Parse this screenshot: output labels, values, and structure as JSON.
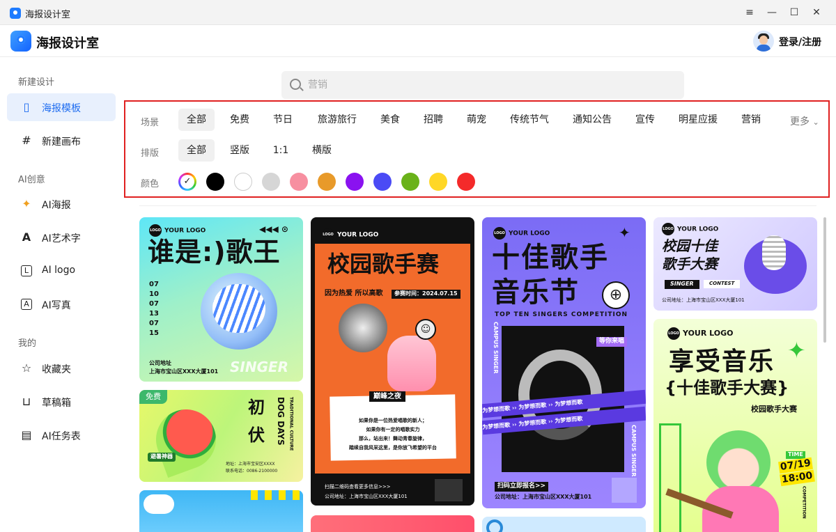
{
  "window": {
    "title": "海报设计室",
    "controls": [
      "≡",
      "—",
      "☐",
      "✕"
    ]
  },
  "header": {
    "app_name": "海报设计室",
    "login_label": "登录/注册"
  },
  "sidebar": {
    "section_new": "新建设计",
    "items_new": [
      {
        "label": "海报模板",
        "icon": "poster-icon"
      },
      {
        "label": "新建画布",
        "icon": "grid-canvas-icon"
      }
    ],
    "section_ai": "AI创意",
    "items_ai": [
      {
        "label": "AI海报",
        "icon": "magic-wand-icon"
      },
      {
        "label": "AI艺术字",
        "icon": "art-letter-icon"
      },
      {
        "label": "AI logo",
        "icon": "logo-icon"
      },
      {
        "label": "AI写真",
        "icon": "photo-icon"
      }
    ],
    "section_mine": "我的",
    "items_mine": [
      {
        "label": "收藏夹",
        "icon": "star-icon"
      },
      {
        "label": "草稿箱",
        "icon": "inbox-icon"
      },
      {
        "label": "AI任务表",
        "icon": "clipboard-icon"
      }
    ]
  },
  "search": {
    "placeholder": "营销"
  },
  "filters": {
    "scene_label": "场景",
    "scenes": [
      "全部",
      "免费",
      "节日",
      "旅游旅行",
      "美食",
      "招聘",
      "萌宠",
      "传统节气",
      "通知公告",
      "宣传",
      "明星应援",
      "营销"
    ],
    "more_label": "更多",
    "layout_label": "排版",
    "layouts": [
      "全部",
      "竖版",
      "1:1",
      "横版"
    ],
    "color_label": "颜色",
    "colors": [
      "#000000",
      "#ffffff",
      "#d6d6d6",
      "#f78fa0",
      "#e89a2a",
      "#8a12f0",
      "#4b4bf5",
      "#6ab21a",
      "#ffd726",
      "#f42a2a"
    ]
  },
  "posters": {
    "p1": {
      "logo": "YOUR LOGO",
      "title": "谁是:)歌王",
      "dates": "07\n10\n07\n13\n07\n15",
      "addr_label": "公司地址",
      "addr": "上海市宝山区XXX大厦101",
      "tag": "SINGER"
    },
    "p2": {
      "badge": "免费",
      "title_a": "初",
      "title_b": "伏",
      "en": "DOG DAYS",
      "sub": "TRADITIONAL CULTURE",
      "tag": "避暑神器",
      "addr": "地址：上海市宝安区XXXX",
      "phone": "联系电话：0086-2100000"
    },
    "p3": {
      "logo": "YOUR LOGO",
      "title": "校园歌手赛",
      "slogan": "因为热爱 所以高歌",
      "time": "参赛时间：2024.07.15",
      "night": "巅峰之夜",
      "body": "如果你是一位热爱唱歌的新人；\n如果你有一定的唱歌实力\n那么，站出来！舞动青春旋律，\n踏续自我风采这里，是你放飞希望的平台",
      "scan": "扫描二维码查看更多信息>>>",
      "addr": "公司地址：上海市宝山区XXX大厦101"
    },
    "p4": {
      "logo": "YOUR LOGO",
      "title_a": "十佳歌手",
      "title_b": "音乐节",
      "en": "TOP TEN SINGERS COMPETITION",
      "side": "CAMPUS SINGER",
      "wait": "等你来唱",
      "band": "为梦想而歌",
      "signup": "扫码立即报名>>",
      "addr": "公司地址：上海市宝山区XXX大厦101"
    },
    "p5": {
      "logo": "YOUR LOGO",
      "title_a": "校园十佳",
      "title_b": "歌手大赛",
      "tag_a": "SINGER",
      "tag_b": "CONTEST",
      "addr": "公司地址：上海市宝山区XXX大厦101"
    },
    "p6": {
      "logo": "YOUR LOGO",
      "title_a": "享受音乐",
      "title_b": "{十佳歌手大赛}",
      "sub": "校园歌手大赛",
      "time_a": "TIME",
      "time_b": "07/19",
      "time_c": "18:00",
      "side": "COMPETITION"
    }
  }
}
